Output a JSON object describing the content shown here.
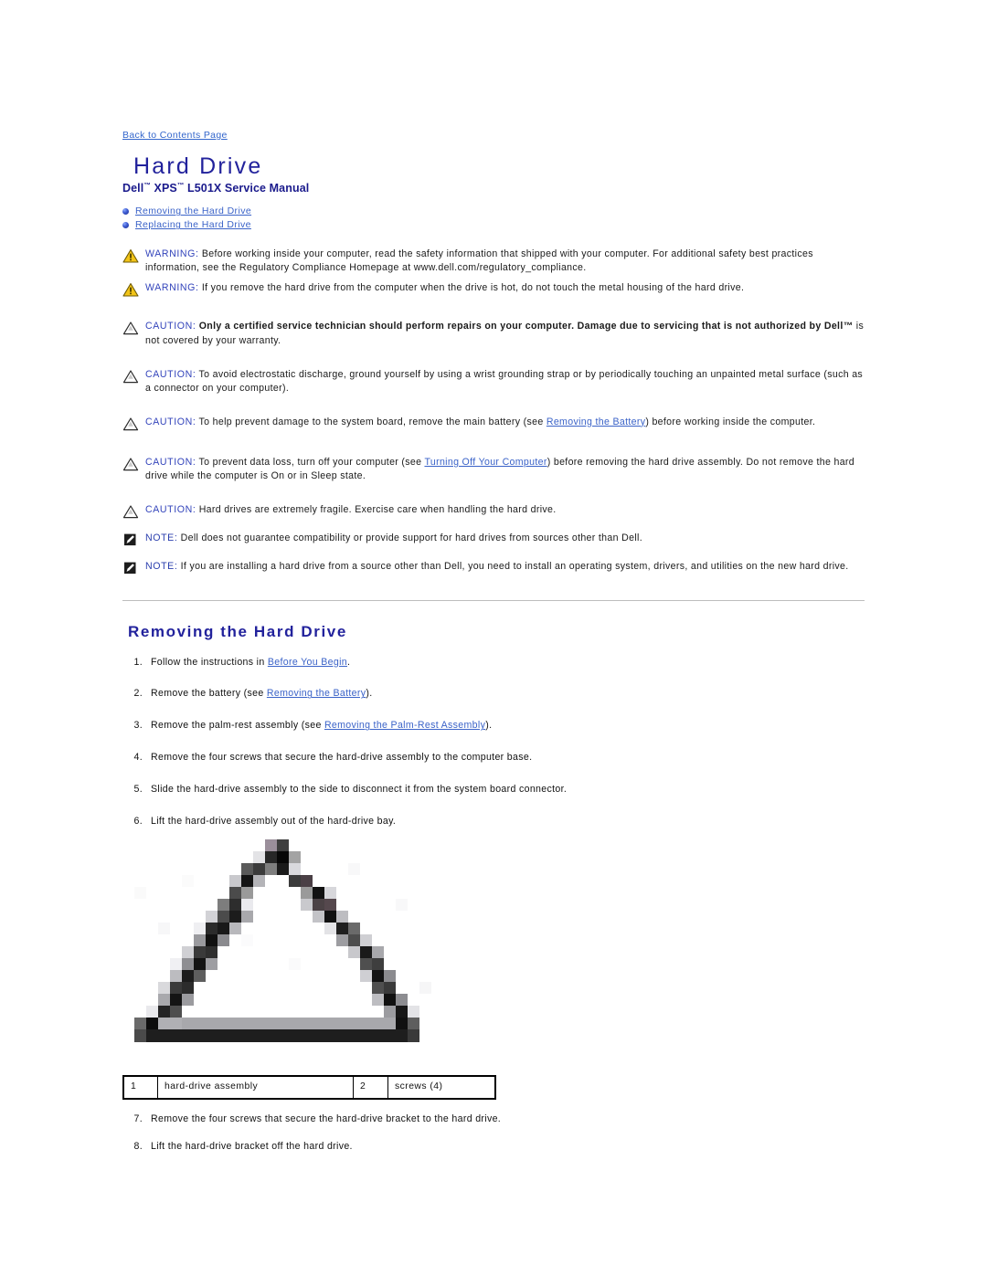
{
  "nav": {
    "back_to_contents": "Back to Contents Page"
  },
  "header": {
    "title": "Hard Drive",
    "subtitle_prefix": "Dell",
    "subtitle_tm1": "™",
    "subtitle_mid": " XPS",
    "subtitle_tm2": "™",
    "subtitle_suffix": " L501X Service Manual"
  },
  "toc": {
    "items": [
      {
        "label": "Removing the Hard Drive"
      },
      {
        "label": "Replacing the Hard Drive"
      }
    ]
  },
  "admonitions": [
    {
      "kind": "warning",
      "icon": "warning-triangle-icon",
      "lead": "WARNING:",
      "text": " Before working inside your computer, read the safety information that shipped with your computer. For additional safety best practices information, see the Regulatory Compliance Homepage at www.dell.com/regulatory_compliance."
    },
    {
      "kind": "warning",
      "icon": "warning-triangle-icon",
      "lead": "WARNING:",
      "text": " If you remove the hard drive from the computer when the drive is hot, do not touch the metal housing of the hard drive."
    },
    {
      "kind": "caution-bold",
      "icon": "caution-triangle-icon",
      "lead": "CAUTION:",
      "bold_text": " Only a certified service technician should perform repairs on your computer. Damage due to servicing that is not authorized by Dell™",
      "text": " is not covered by your warranty."
    },
    {
      "kind": "caution",
      "icon": "caution-triangle-icon",
      "lead": "CAUTION:",
      "text": " To avoid electrostatic discharge, ground yourself by using a wrist grounding strap or by periodically touching an unpainted metal surface (such as a connector on your computer)."
    },
    {
      "kind": "caution-link",
      "icon": "caution-triangle-icon",
      "lead": "CAUTION:",
      "text_before": " To help prevent damage to the system board, remove the main battery (see ",
      "link": "Removing the Battery",
      "text_after": ") before working inside the computer."
    },
    {
      "kind": "caution-link",
      "icon": "caution-triangle-icon",
      "lead": "CAUTION:",
      "text_before": " To prevent data loss, turn off your computer (see ",
      "link": "Turning Off Your Computer",
      "text_after": ") before removing the hard drive assembly. Do not remove the hard drive while the computer is On or in Sleep state."
    },
    {
      "kind": "caution",
      "icon": "caution-triangle-icon",
      "lead": "CAUTION:",
      "text": " Hard drives are extremely fragile. Exercise care when handling the hard drive."
    },
    {
      "kind": "note",
      "icon": "note-pencil-icon",
      "lead": "NOTE:",
      "text": " Dell does not guarantee compatibility or provide support for hard drives from sources other than Dell."
    },
    {
      "kind": "note",
      "icon": "note-pencil-icon",
      "lead": "NOTE:",
      "text": " If you are installing a hard drive from a source other than Dell, you need to install an operating system, drivers, and utilities on the new hard drive."
    }
  ],
  "section": {
    "heading": "Removing the Hard Drive"
  },
  "steps_before_figure": [
    {
      "num": "1.",
      "text_before": "Follow the instructions in ",
      "link": "Before You Begin",
      "text_after": "."
    },
    {
      "num": "2.",
      "text_before": "Remove the battery (see ",
      "link": "Removing the Battery",
      "text_after": ")."
    },
    {
      "num": "3.",
      "text_before": "Remove the palm-rest assembly (see ",
      "link": "Removing the Palm-Rest Assembly",
      "text_after": ")."
    },
    {
      "num": "4.",
      "text_before": "Remove the four screws that secure the hard-drive assembly to the computer base.",
      "link": "",
      "text_after": ""
    },
    {
      "num": "5.",
      "text_before": "Slide the hard-drive assembly to the side to disconnect it from the system board connector.",
      "link": "",
      "text_after": ""
    },
    {
      "num": "6.",
      "text_before": "Lift the hard-drive assembly out of the hard-drive bay.",
      "link": "",
      "text_after": ""
    }
  ],
  "figure": {
    "alt": "broken-image-placeholder",
    "callouts": {
      "key1": "1",
      "value1": "hard-drive assembly",
      "key2": "2",
      "value2": "screws (4)"
    }
  },
  "steps_after_figure": [
    {
      "num": "7.",
      "text_before": "Remove the four screws that secure the hard-drive bracket to the hard drive.",
      "link": "",
      "text_after": ""
    },
    {
      "num": "8.",
      "text_before": "Lift the hard-drive bracket off the hard drive.",
      "link": "",
      "text_after": ""
    }
  ],
  "colors": {
    "heading_blue": "#22229c",
    "link_blue": "#3b63c8",
    "lead_blue": "#3344bb",
    "warning_yellow": "#f2c417",
    "rule_gray": "#bdbdbd"
  }
}
